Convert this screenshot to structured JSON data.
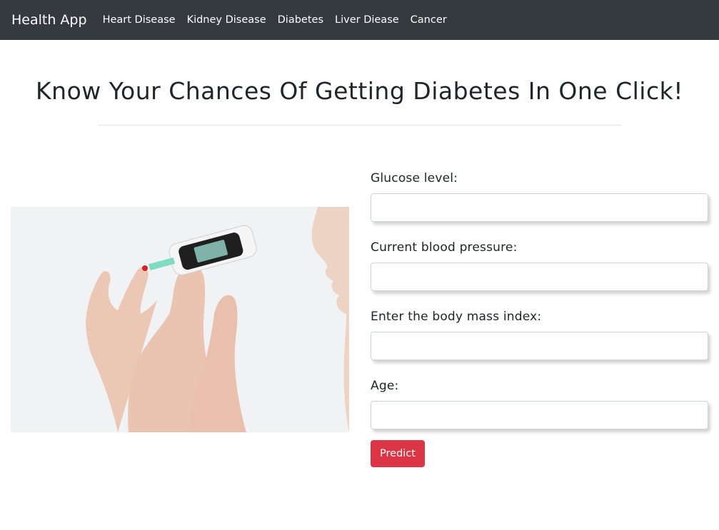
{
  "navbar": {
    "brand": "Health App",
    "links": [
      "Heart Disease",
      "Kidney Disease",
      "Diabetes",
      "Liver Diease",
      "Cancer"
    ]
  },
  "page": {
    "title": "Know Your Chances Of Getting Diabetes In One Click!"
  },
  "form": {
    "fields": [
      {
        "label": "Glucose level:",
        "value": ""
      },
      {
        "label": "Current blood pressure:",
        "value": ""
      },
      {
        "label": "Enter the body mass index:",
        "value": ""
      },
      {
        "label": "Age:",
        "value": ""
      }
    ],
    "submit_label": "Predict"
  },
  "colors": {
    "navbar_bg": "#343a40",
    "button_bg": "#dc3545"
  }
}
